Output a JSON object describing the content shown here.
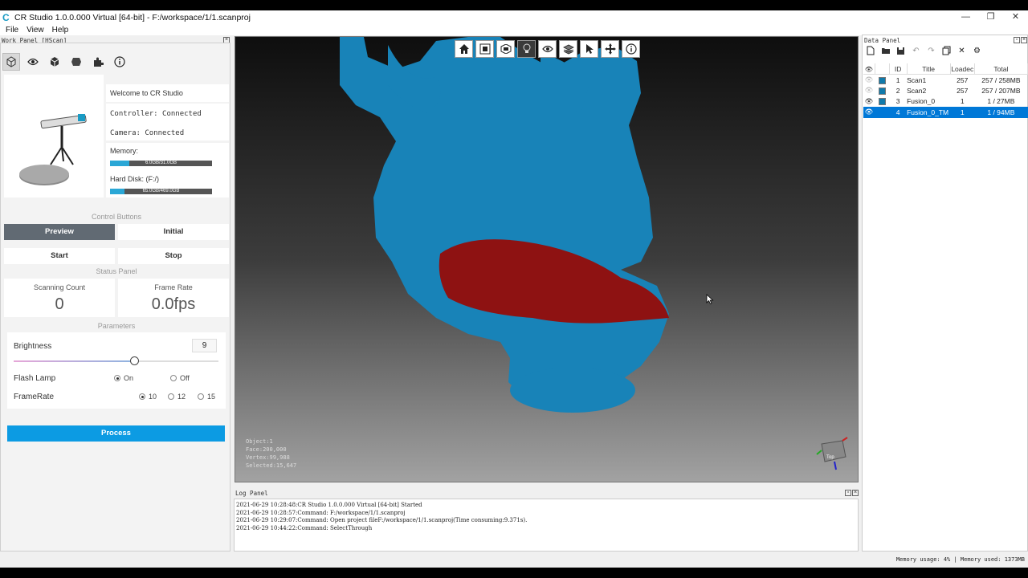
{
  "window": {
    "title": "CR Studio 1.0.0.000 Virtual [64-bit] - F:/workspace/1/1.scanproj",
    "minimize": "—",
    "restore": "❐",
    "close": "✕"
  },
  "menu": [
    "File",
    "View",
    "Help"
  ],
  "work_panel": {
    "header": "Work Panel [HScan]",
    "toolbar_icons": [
      "scan-cube-icon",
      "eye-icon",
      "box-icon",
      "mesh-icon",
      "plugin-icon",
      "info-icon"
    ],
    "welcome": "Welcome to CR Studio",
    "controller": "Controller: Connected",
    "camera": "Camera: Connected",
    "memory_label": "Memory:",
    "memory_value": "6.0GB/31.0GB",
    "memory_fraction": 0.19,
    "disk_label": "Hard Disk: (F:/)",
    "disk_value": "65.0GB/469.0GB",
    "disk_fraction": 0.14,
    "control_buttons_label": "Control Buttons",
    "preview": "Preview",
    "initial": "Initial",
    "start": "Start",
    "stop": "Stop",
    "status_panel_label": "Status Panel",
    "scanning_count_label": "Scanning Count",
    "scanning_count": "0",
    "frame_rate_label": "Frame Rate",
    "frame_rate": "0.0fps",
    "parameters_label": "Parameters",
    "brightness_label": "Brightness",
    "brightness_value": "9",
    "brightness_fraction": 0.59,
    "flash_lamp_label": "Flash Lamp",
    "flash_on": "On",
    "flash_off": "Off",
    "framerate_label": "FrameRate",
    "fr_10": "10",
    "fr_12": "12",
    "fr_15": "15",
    "process": "Process"
  },
  "viewport": {
    "toolbar_icons": [
      "home-icon",
      "fit-view-icon",
      "view-mode-icon",
      "light-icon",
      "visibility-icon",
      "layers-icon",
      "select-icon",
      "move-icon",
      "info-icon"
    ],
    "stats": {
      "object": "Object:1",
      "face": "Face:200,000",
      "vertex": "Vertex:99,988",
      "selected": "Selected:15,647"
    },
    "colors": {
      "mesh": "#1883b8",
      "selection": "#8e1212"
    },
    "axis_top_label": "Top"
  },
  "log_panel": {
    "header": "Log Panel",
    "lines": [
      "2021-06-29 10:28:48:CR Studio 1.0.0.000 Virtual [64-bit] Started",
      "2021-06-29 10:28:57:Command: F:/workspace/1/1.scanproj",
      "2021-06-29 10:29:07:Command: Open project fileF:/workspace/1/1.scanproj(Time consuming:9.371s).",
      "2021-06-29 10:44:22:Command: SelectThrough"
    ]
  },
  "data_panel": {
    "header": "Data Panel",
    "columns": [
      "",
      "",
      "ID",
      "Title",
      "Loadec",
      "Total"
    ],
    "rows": [
      {
        "id": "1",
        "title": "Scan1",
        "loaded": "257",
        "total": "257 / 258MB",
        "visible": false,
        "selected": false
      },
      {
        "id": "2",
        "title": "Scan2",
        "loaded": "257",
        "total": "257 / 207MB",
        "visible": false,
        "selected": false
      },
      {
        "id": "3",
        "title": "Fusion_0",
        "loaded": "1",
        "total": "1 / 27MB",
        "visible": true,
        "selected": false
      },
      {
        "id": "4",
        "title": "Fusion_0_TM",
        "loaded": "1",
        "total": "1 / 94MB",
        "visible": true,
        "selected": true
      }
    ]
  },
  "status_bar": {
    "text": "Memory usage: 4% | Memory used: 1373MB"
  }
}
